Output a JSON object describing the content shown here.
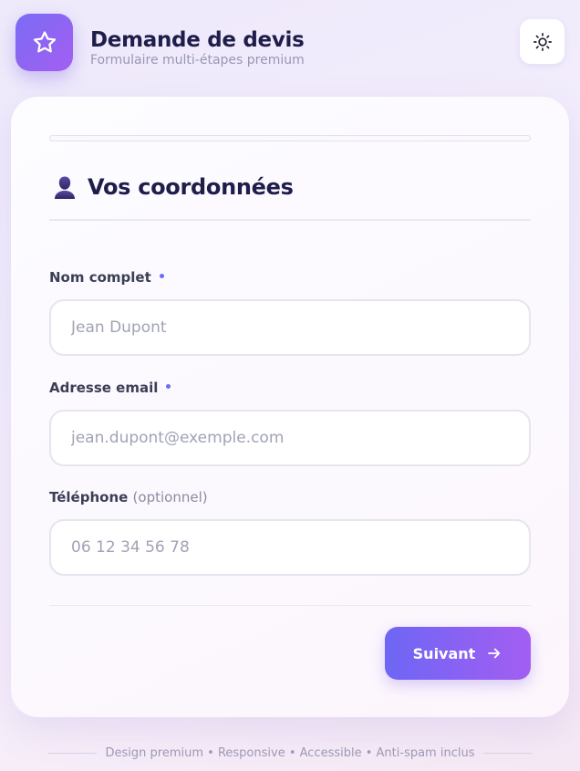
{
  "header": {
    "title": "Demande de devis",
    "subtitle": "Formulaire multi-étapes premium",
    "logo_icon": "star-icon",
    "theme_icon": "sun-icon"
  },
  "progress": {
    "value": 0
  },
  "section": {
    "icon": "user-icon",
    "title": "Vos coordonnées"
  },
  "fields": {
    "name": {
      "label": "Nom complet",
      "required": true,
      "value": "",
      "placeholder": "Jean Dupont"
    },
    "email": {
      "label": "Adresse email",
      "required": true,
      "value": "",
      "placeholder": "jean.dupont@exemple.com"
    },
    "phone": {
      "label": "Téléphone",
      "optional_note": "(optionnel)",
      "value": "",
      "placeholder": "06 12 34 56 78"
    }
  },
  "actions": {
    "next_label": "Suivant",
    "next_icon": "arrow-right-icon"
  },
  "footer": {
    "text": "Design premium • Responsive • Accessible • Anti-spam inclus"
  },
  "colors": {
    "accent_start": "#6b6cf6",
    "accent_end": "#a35ef2",
    "title": "#1f1d4a",
    "muted": "#9a96b5"
  }
}
